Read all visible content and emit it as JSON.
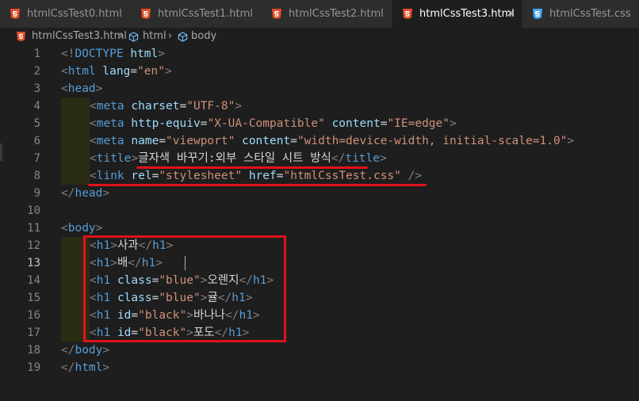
{
  "tabs": [
    {
      "label": "htmlCssTest0.html",
      "icon": "html5-file-icon",
      "active": false
    },
    {
      "label": "htmlCssTest1.html",
      "icon": "html5-file-icon",
      "active": false
    },
    {
      "label": "htmlCssTest2.html",
      "icon": "html5-file-icon",
      "active": false
    },
    {
      "label": "htmlCssTest3.html",
      "icon": "html5-file-icon",
      "active": true
    },
    {
      "label": "htmlCssTest.css",
      "icon": "css3-file-icon",
      "active": false
    }
  ],
  "close_label": "×",
  "breadcrumb": {
    "file": "htmlCssTest3.html",
    "sep": "›",
    "items": [
      "html",
      "body"
    ]
  },
  "editor": {
    "current_line": 13,
    "lines": [
      {
        "n": "1",
        "tokens": [
          [
            "<!",
            "p"
          ],
          [
            "DOCTYPE",
            "t"
          ],
          [
            " ",
            "x"
          ],
          [
            "html",
            "a"
          ],
          [
            ">",
            "p"
          ]
        ]
      },
      {
        "n": "2",
        "tokens": [
          [
            "<",
            "p"
          ],
          [
            "html",
            "t"
          ],
          [
            " ",
            "x"
          ],
          [
            "lang",
            "a"
          ],
          [
            "=",
            "x"
          ],
          [
            "\"en\"",
            "s"
          ],
          [
            ">",
            "p"
          ]
        ]
      },
      {
        "n": "3",
        "tokens": [
          [
            "<",
            "p"
          ],
          [
            "head",
            "t"
          ],
          [
            ">",
            "p"
          ]
        ]
      },
      {
        "n": "4",
        "indent": 1,
        "tokens": [
          [
            "<",
            "p"
          ],
          [
            "meta",
            "t"
          ],
          [
            " ",
            "x"
          ],
          [
            "charset",
            "a"
          ],
          [
            "=",
            "x"
          ],
          [
            "\"UTF-8\"",
            "s"
          ],
          [
            ">",
            "p"
          ]
        ]
      },
      {
        "n": "5",
        "indent": 1,
        "tokens": [
          [
            "<",
            "p"
          ],
          [
            "meta",
            "t"
          ],
          [
            " ",
            "x"
          ],
          [
            "http-equiv",
            "a"
          ],
          [
            "=",
            "x"
          ],
          [
            "\"X-UA-Compatible\"",
            "s"
          ],
          [
            " ",
            "x"
          ],
          [
            "content",
            "a"
          ],
          [
            "=",
            "x"
          ],
          [
            "\"IE=edge\"",
            "s"
          ],
          [
            ">",
            "p"
          ]
        ]
      },
      {
        "n": "6",
        "indent": 1,
        "tokens": [
          [
            "<",
            "p"
          ],
          [
            "meta",
            "t"
          ],
          [
            " ",
            "x"
          ],
          [
            "name",
            "a"
          ],
          [
            "=",
            "x"
          ],
          [
            "\"viewport\"",
            "s"
          ],
          [
            " ",
            "x"
          ],
          [
            "content",
            "a"
          ],
          [
            "=",
            "x"
          ],
          [
            "\"width=device-width, initial-scale=1.0\"",
            "s"
          ],
          [
            ">",
            "p"
          ]
        ]
      },
      {
        "n": "7",
        "indent": 1,
        "tokens": [
          [
            "<",
            "p"
          ],
          [
            "title",
            "t"
          ],
          [
            ">",
            "p"
          ],
          [
            "글자색 바꾸기:외부 스타일 시트 방식",
            "x"
          ],
          [
            "</",
            "p"
          ],
          [
            "title",
            "t"
          ],
          [
            ">",
            "p"
          ]
        ]
      },
      {
        "n": "8",
        "indent": 1,
        "tokens": [
          [
            "<",
            "p"
          ],
          [
            "link",
            "t"
          ],
          [
            " ",
            "x"
          ],
          [
            "rel",
            "a"
          ],
          [
            "=",
            "x"
          ],
          [
            "\"stylesheet\"",
            "s"
          ],
          [
            " ",
            "x"
          ],
          [
            "href",
            "a"
          ],
          [
            "=",
            "x"
          ],
          [
            "\"htmlCssTest.css\"",
            "s"
          ],
          [
            " ",
            "x"
          ],
          [
            "/>",
            "p"
          ]
        ]
      },
      {
        "n": "9",
        "tokens": [
          [
            "</",
            "p"
          ],
          [
            "head",
            "t"
          ],
          [
            ">",
            "p"
          ]
        ]
      },
      {
        "n": "10",
        "tokens": []
      },
      {
        "n": "11",
        "tokens": [
          [
            "<",
            "p"
          ],
          [
            "body",
            "t"
          ],
          [
            ">",
            "p"
          ]
        ]
      },
      {
        "n": "12",
        "indent": 1,
        "tokens": [
          [
            "<",
            "p"
          ],
          [
            "h1",
            "t"
          ],
          [
            ">",
            "p"
          ],
          [
            "사과",
            "x"
          ],
          [
            "</",
            "p"
          ],
          [
            "h1",
            "t"
          ],
          [
            ">",
            "p"
          ]
        ]
      },
      {
        "n": "13",
        "indent": 1,
        "tokens": [
          [
            "<",
            "p"
          ],
          [
            "h1",
            "t"
          ],
          [
            ">",
            "p"
          ],
          [
            "배",
            "x"
          ],
          [
            "</",
            "p"
          ],
          [
            "h1",
            "t"
          ],
          [
            ">",
            "p"
          ]
        ]
      },
      {
        "n": "14",
        "indent": 1,
        "tokens": [
          [
            "<",
            "p"
          ],
          [
            "h1",
            "t"
          ],
          [
            " ",
            "x"
          ],
          [
            "class",
            "a"
          ],
          [
            "=",
            "x"
          ],
          [
            "\"blue\"",
            "s"
          ],
          [
            ">",
            "p"
          ],
          [
            "오렌지",
            "x"
          ],
          [
            "</",
            "p"
          ],
          [
            "h1",
            "t"
          ],
          [
            ">",
            "p"
          ]
        ]
      },
      {
        "n": "15",
        "indent": 1,
        "tokens": [
          [
            "<",
            "p"
          ],
          [
            "h1",
            "t"
          ],
          [
            " ",
            "x"
          ],
          [
            "class",
            "a"
          ],
          [
            "=",
            "x"
          ],
          [
            "\"blue\"",
            "s"
          ],
          [
            ">",
            "p"
          ],
          [
            "귤",
            "x"
          ],
          [
            "</",
            "p"
          ],
          [
            "h1",
            "t"
          ],
          [
            ">",
            "p"
          ]
        ]
      },
      {
        "n": "16",
        "indent": 1,
        "tokens": [
          [
            "<",
            "p"
          ],
          [
            "h1",
            "t"
          ],
          [
            " ",
            "x"
          ],
          [
            "id",
            "a"
          ],
          [
            "=",
            "x"
          ],
          [
            "\"black\"",
            "s"
          ],
          [
            ">",
            "p"
          ],
          [
            "바나나",
            "x"
          ],
          [
            "</",
            "p"
          ],
          [
            "h1",
            "t"
          ],
          [
            ">",
            "p"
          ]
        ]
      },
      {
        "n": "17",
        "indent": 1,
        "tokens": [
          [
            "<",
            "p"
          ],
          [
            "h1",
            "t"
          ],
          [
            " ",
            "x"
          ],
          [
            "id",
            "a"
          ],
          [
            "=",
            "x"
          ],
          [
            "\"black\"",
            "s"
          ],
          [
            ">",
            "p"
          ],
          [
            "포도",
            "x"
          ],
          [
            "</",
            "p"
          ],
          [
            "h1",
            "t"
          ],
          [
            ">",
            "p"
          ]
        ]
      },
      {
        "n": "18",
        "tokens": [
          [
            "</",
            "p"
          ],
          [
            "body",
            "t"
          ],
          [
            ">",
            "p"
          ]
        ]
      },
      {
        "n": "19",
        "tokens": [
          [
            "</",
            "p"
          ],
          [
            "html",
            "t"
          ],
          [
            ">",
            "p"
          ]
        ]
      }
    ]
  },
  "colors": {
    "punctuation": "#808080",
    "tag": "#569cd6",
    "attribute": "#9cdcfe",
    "string": "#ce9178",
    "text": "#d4d4d4",
    "annotation_red": "#e0121a",
    "html_icon": "#e44d26",
    "css_icon": "#42a5f5"
  }
}
